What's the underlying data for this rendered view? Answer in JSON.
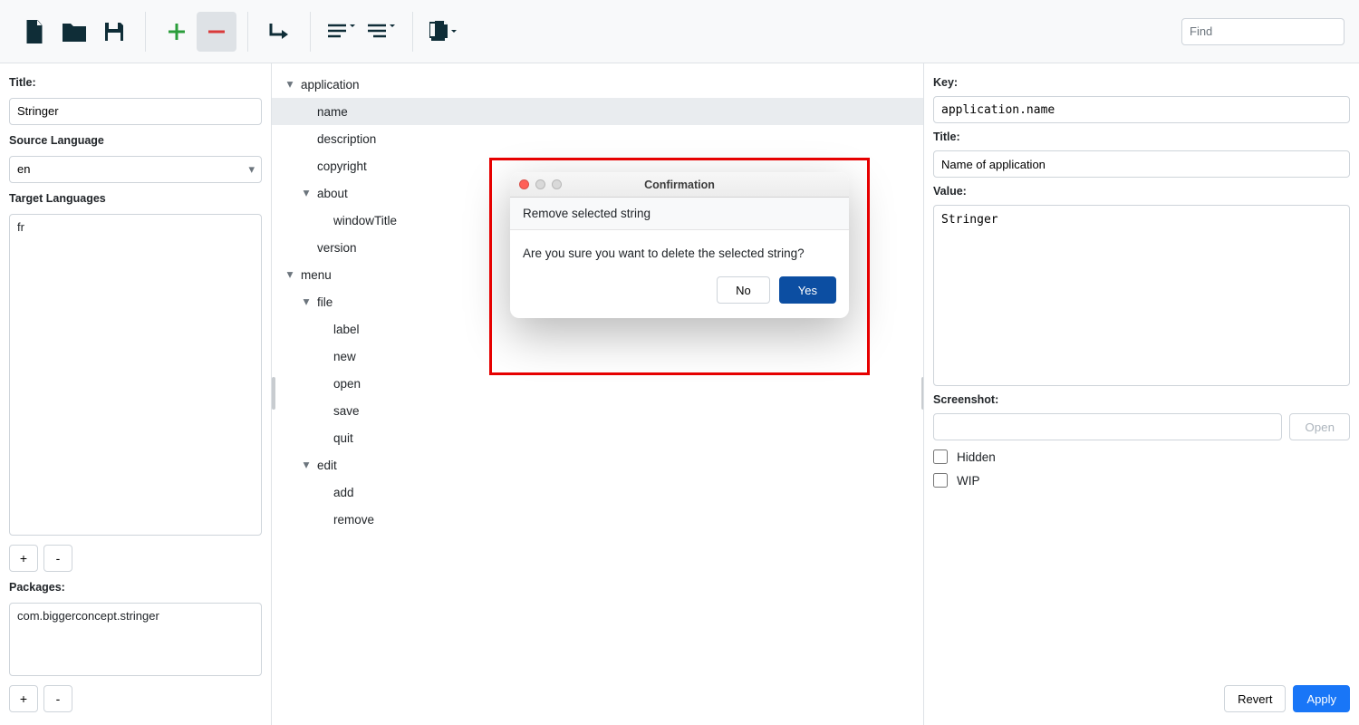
{
  "toolbar": {
    "find_placeholder": "Find"
  },
  "left": {
    "title_label": "Title:",
    "title_value": "Stringer",
    "source_lang_label": "Source Language",
    "source_lang_value": "en",
    "target_lang_label": "Target Languages",
    "target_lang_value": "fr",
    "add_label": "+",
    "remove_label": "-",
    "packages_label": "Packages:",
    "packages_value": "com.biggerconcept.stringer",
    "pkg_add_label": "+",
    "pkg_remove_label": "-"
  },
  "tree": {
    "items": [
      {
        "label": "application",
        "indent": 0,
        "expandable": true
      },
      {
        "label": "name",
        "indent": 1,
        "expandable": false,
        "selected": true
      },
      {
        "label": "description",
        "indent": 1,
        "expandable": false
      },
      {
        "label": "copyright",
        "indent": 1,
        "expandable": false
      },
      {
        "label": "about",
        "indent": 1,
        "expandable": true
      },
      {
        "label": "windowTitle",
        "indent": 2,
        "expandable": false
      },
      {
        "label": "version",
        "indent": 1,
        "expandable": false
      },
      {
        "label": "menu",
        "indent": 0,
        "expandable": true
      },
      {
        "label": "file",
        "indent": 1,
        "expandable": true
      },
      {
        "label": "label",
        "indent": 2,
        "expandable": false
      },
      {
        "label": "new",
        "indent": 2,
        "expandable": false
      },
      {
        "label": "open",
        "indent": 2,
        "expandable": false
      },
      {
        "label": "save",
        "indent": 2,
        "expandable": false
      },
      {
        "label": "quit",
        "indent": 2,
        "expandable": false
      },
      {
        "label": "edit",
        "indent": 1,
        "expandable": true
      },
      {
        "label": "add",
        "indent": 2,
        "expandable": false
      },
      {
        "label": "remove",
        "indent": 2,
        "expandable": false
      }
    ]
  },
  "right": {
    "key_label": "Key:",
    "key_value": "application.name",
    "title_label": "Title:",
    "title_value": "Name of application",
    "value_label": "Value:",
    "value_value": "Stringer",
    "screenshot_label": "Screenshot:",
    "open_label": "Open",
    "hidden_label": "Hidden",
    "wip_label": "WIP",
    "revert_label": "Revert",
    "apply_label": "Apply"
  },
  "dialog": {
    "title": "Confirmation",
    "subtitle": "Remove selected string",
    "body": "Are you sure you want to delete the selected string?",
    "no_label": "No",
    "yes_label": "Yes"
  }
}
